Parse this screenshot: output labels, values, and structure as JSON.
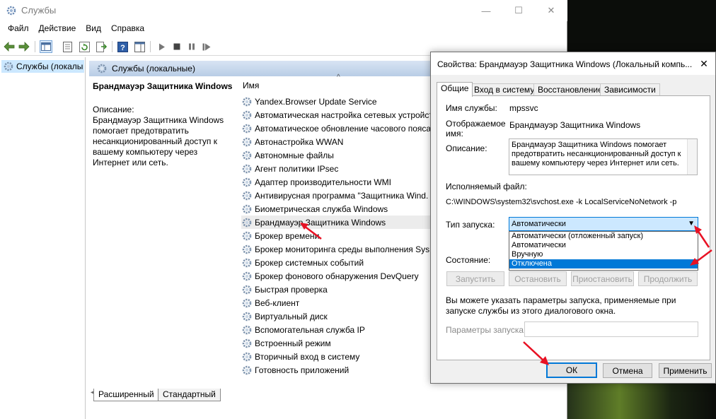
{
  "window": {
    "title": "Службы",
    "minimize": "—",
    "maximize": "☐",
    "close": "✕"
  },
  "menu": [
    "Файл",
    "Действие",
    "Вид",
    "Справка"
  ],
  "tree": {
    "root_label": "Службы (локалы"
  },
  "pane": {
    "header": "Службы (локальные)"
  },
  "description": {
    "service_title": "Брандмауэр Защитника Windows",
    "label": "Описание:",
    "text": "Брандмауэр Защитника Windows помогает предотвратить несанкционированный доступ к вашему компьютеру через Интернет или сеть."
  },
  "list": {
    "column_name": "Имя",
    "sort_indicator": "^",
    "rows": [
      "Yandex.Browser Update Service",
      "Автоматическая настройка сетевых устройст",
      "Автоматическое обновление часового пояса",
      "Автонастройка WWAN",
      "Автономные файлы",
      "Агент политики IPsec",
      "Адаптер производительности WMI",
      "Антивирусная программа \"Защитника Wind.",
      "Биометрическая служба Windows",
      "Брандмауэр Защитника Windows",
      "Брокер времени",
      "Брокер мониторинга среды выполнения Sys",
      "Брокер системных событий",
      "Брокер фонового обнаружения DevQuery",
      "Быстрая проверка",
      "Веб-клиент",
      "Виртуальный диск",
      "Вспомогательная служба IP",
      "Встроенный режим",
      "Вторичный вход в систему",
      "Готовность приложений"
    ],
    "selected_index": 9
  },
  "bottom_tabs": [
    "Расширенный",
    "Стандартный"
  ],
  "dialog": {
    "title": "Свойства: Брандмауэр Защитника Windows (Локальный компь...",
    "close": "✕",
    "tabs": [
      "Общие",
      "Вход в систему",
      "Восстановление",
      "Зависимости"
    ],
    "service_name_label": "Имя службы:",
    "service_name": "mpssvc",
    "display_name_label": "Отображаемое имя:",
    "display_name": "Брандмауэр Защитника Windows",
    "description_label": "Описание:",
    "description": "Брандмауэр Защитника Windows помогает предотвратить несанкционированный доступ к вашему компьютеру через Интернет или сеть.",
    "exe_label": "Исполняемый файл:",
    "exe_path": "C:\\WINDOWS\\system32\\svchost.exe -k LocalServiceNoNetwork -p",
    "startup_label": "Тип запуска:",
    "startup_value": "Автоматически",
    "startup_options": [
      "Автоматически (отложенный запуск)",
      "Автоматически",
      "Вручную",
      "Отключена"
    ],
    "startup_highlighted_index": 3,
    "status_label": "Состояние:",
    "buttons": {
      "start": "Запустить",
      "stop": "Остановить",
      "pause": "Приостановить",
      "resume": "Продолжить"
    },
    "hint": "Вы можете указать параметры запуска, применяемые при запуске службы из этого диалогового окна.",
    "params_label": "Параметры запуска:",
    "ok": "ОК",
    "cancel": "Отмена",
    "apply": "Применить"
  },
  "colors": {
    "selection": "#cce8ff",
    "accent": "#0078d7",
    "annotation_arrow": "#e81123"
  }
}
